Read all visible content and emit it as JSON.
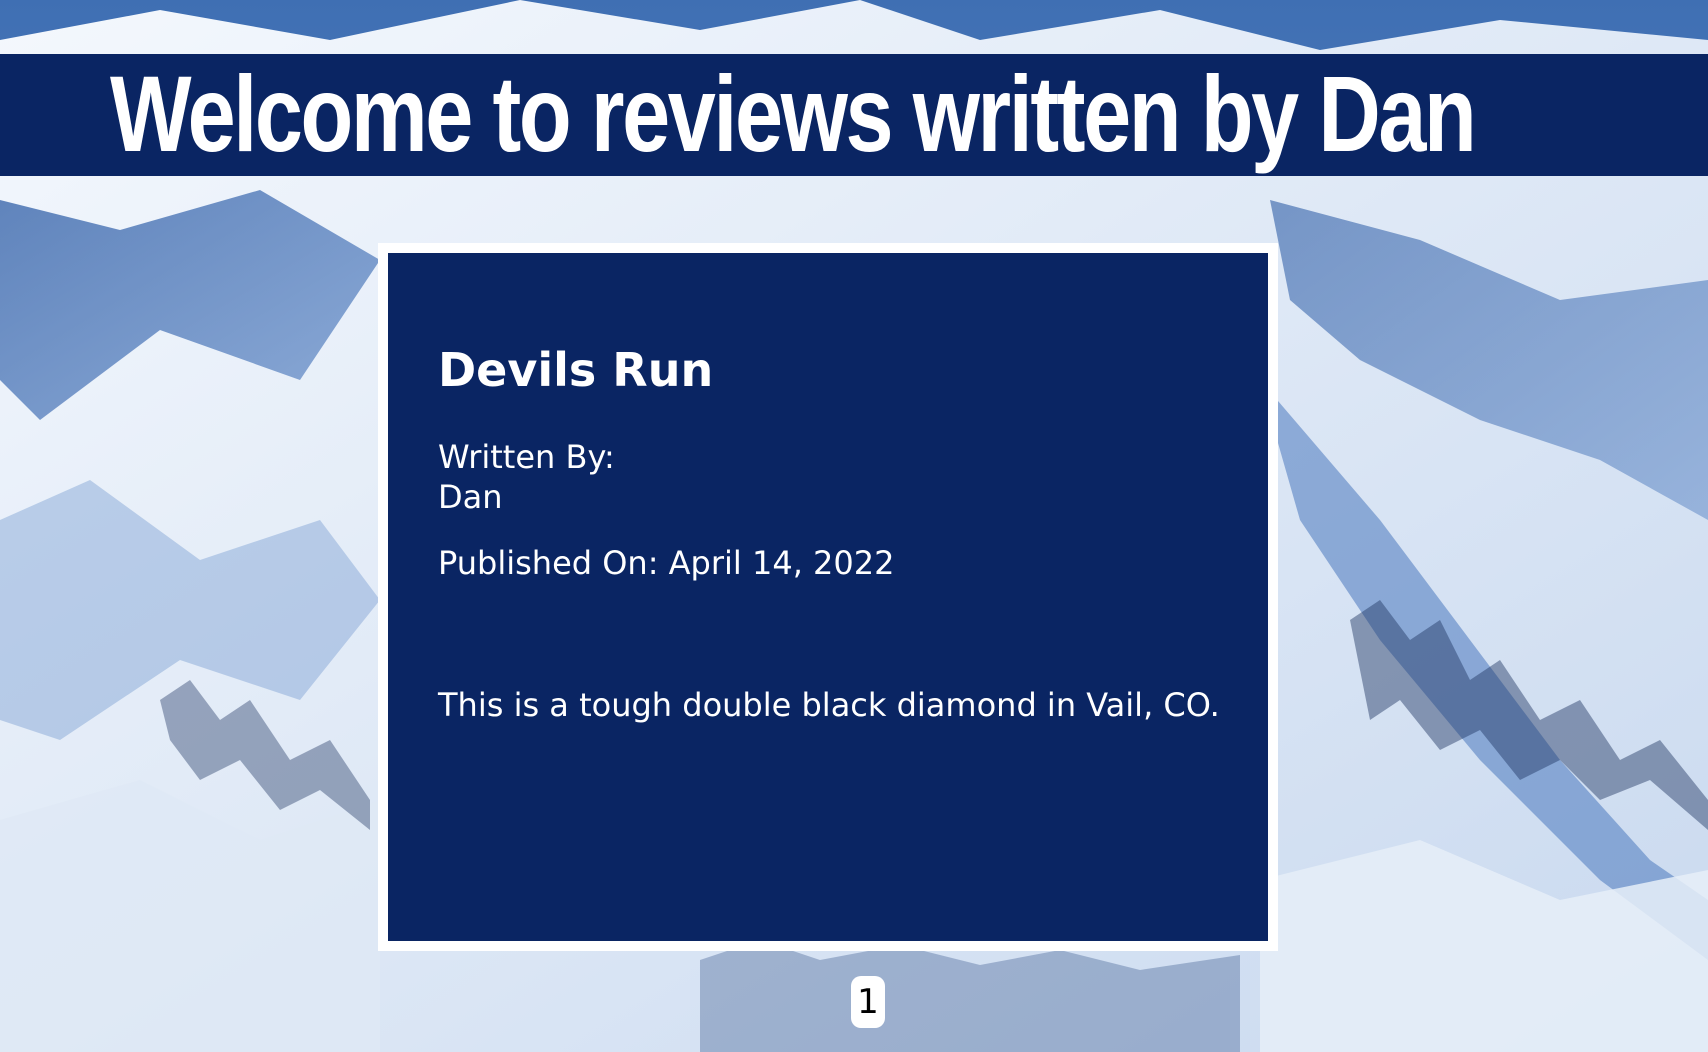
{
  "header": {
    "title": "Welcome to reviews written by Dan"
  },
  "review": {
    "title": "Devils Run",
    "written_by_label": "Written By:",
    "author": "Dan",
    "published": "Published On: April 14, 2022",
    "body": "This is a tough double black diamond in Vail, CO."
  },
  "pagination": {
    "current_page": "1"
  },
  "colors": {
    "banner": "#0a2563",
    "card": "#0a2563",
    "card_border": "#ffffff",
    "text": "#ffffff"
  }
}
